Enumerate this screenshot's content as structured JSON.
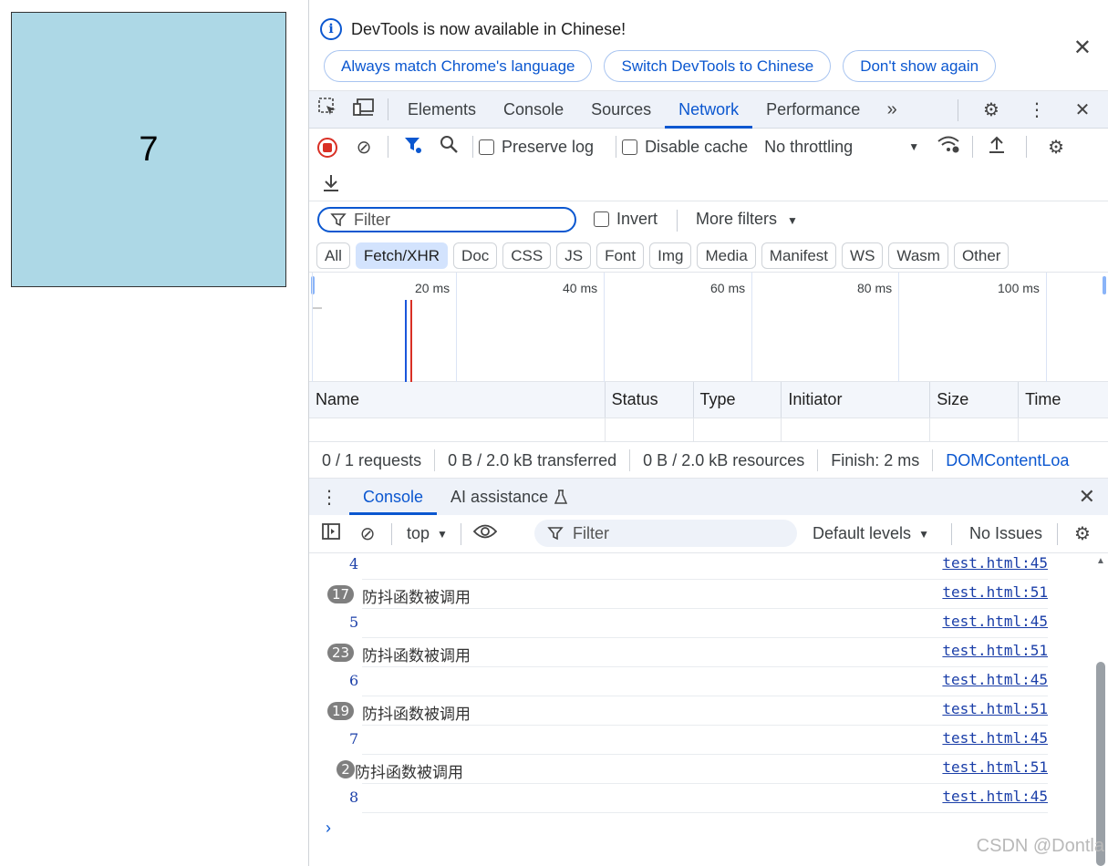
{
  "page": {
    "counter": "7"
  },
  "infobar": {
    "message": "DevTools is now available in Chinese!",
    "buttons": [
      "Always match Chrome's language",
      "Switch DevTools to Chinese",
      "Don't show again"
    ]
  },
  "tabs": [
    "Elements",
    "Console",
    "Sources",
    "Network",
    "Performance"
  ],
  "network": {
    "preserve_log": "Preserve log",
    "disable_cache": "Disable cache",
    "throttling": "No throttling",
    "filter_placeholder": "Filter",
    "invert": "Invert",
    "more_filters": "More filters",
    "types": [
      "All",
      "Fetch/XHR",
      "Doc",
      "CSS",
      "JS",
      "Font",
      "Img",
      "Media",
      "Manifest",
      "WS",
      "Wasm",
      "Other"
    ],
    "selected_type": "Fetch/XHR",
    "timeline_ticks": [
      "20 ms",
      "40 ms",
      "60 ms",
      "80 ms",
      "100 ms"
    ],
    "columns": [
      "Name",
      "Status",
      "Type",
      "Initiator",
      "Size",
      "Time"
    ],
    "status": {
      "requests": "0 / 1 requests",
      "transferred": "0 B / 2.0 kB transferred",
      "resources": "0 B / 2.0 kB resources",
      "finish": "Finish: 2 ms",
      "domcontent": "DOMContentLoa"
    }
  },
  "drawer": {
    "tabs": [
      "Console",
      "AI assistance"
    ],
    "context": "top",
    "filter_placeholder": "Filter",
    "levels": "Default levels",
    "issues": "No Issues"
  },
  "console": {
    "messages": [
      {
        "value": "4",
        "source": "test.html:45"
      },
      {
        "count": "17",
        "text": "防抖函数被调用",
        "source": "test.html:51"
      },
      {
        "value": "5",
        "source": "test.html:45"
      },
      {
        "count": "23",
        "text": "防抖函数被调用",
        "source": "test.html:51"
      },
      {
        "value": "6",
        "source": "test.html:45"
      },
      {
        "count": "19",
        "text": "防抖函数被调用",
        "source": "test.html:51"
      },
      {
        "value": "7",
        "source": "test.html:45"
      },
      {
        "count": "2",
        "text": "防抖函数被调用",
        "source": "test.html:51"
      },
      {
        "value": "8",
        "source": "test.html:45"
      }
    ]
  },
  "watermark": "CSDN @Dontla",
  "colors": {
    "accent": "#0b57d0",
    "record": "#d93025",
    "page_box": "#add8e6"
  }
}
